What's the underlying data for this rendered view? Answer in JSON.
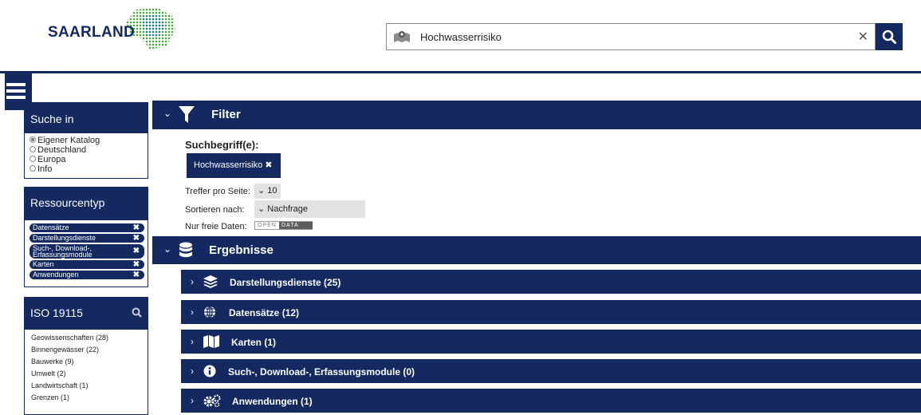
{
  "header": {
    "logo_text": "SAARLAND",
    "search": {
      "value": "Hochwasserrisiko",
      "clear_icon": "close-icon",
      "button_icon": "search-icon"
    }
  },
  "sidebar": {
    "suche_in": {
      "title": "Suche in",
      "options": [
        {
          "label": "Eigener Katalog",
          "selected": true
        },
        {
          "label": "Deutschland",
          "selected": false
        },
        {
          "label": "Europa",
          "selected": false
        },
        {
          "label": "Info",
          "selected": false
        }
      ]
    },
    "ressourcentyp": {
      "title": "Ressourcentyp",
      "items": [
        "Datensätze",
        "Darstellungsdienste",
        "Such-, Download-, Erfassungsmodule",
        "Karten",
        "Anwendungen"
      ],
      "remove_glyph": "✖"
    },
    "iso": {
      "title": "ISO 19115",
      "items": [
        "Geowissenschaften (28)",
        "Binnengewässer (22)",
        "Bauwerke (9)",
        "Umwelt (2)",
        "Landwirtschaft (1)",
        "Grenzen (1)"
      ]
    }
  },
  "filter": {
    "title": "Filter",
    "suchbegriff_label": "Suchbegriff(e):",
    "suchbegriff_chip": "Hochwasserrisiko ✖",
    "treffer_label": "Treffer pro Seite:",
    "treffer_value": "⌄ 10",
    "sort_label": "Sortieren nach:",
    "sort_value": "⌄ Nachfrage",
    "frei_label": "Nur freie Daten:",
    "open_text": "OPEN",
    "data_text": "DATA"
  },
  "results": {
    "title": "Ergebnisse",
    "groups": [
      {
        "label": "Darstellungsdienste (25)",
        "icon": "layers-icon"
      },
      {
        "label": "Datensätze (12)",
        "icon": "globe-icon"
      },
      {
        "label": "Karten (1)",
        "icon": "map-icon"
      },
      {
        "label": "Such-, Download-, Erfassungsmodule (0)",
        "icon": "info-icon"
      },
      {
        "label": "Anwendungen (1)",
        "icon": "gears-icon"
      }
    ]
  },
  "chevron_collapsed": "›",
  "chevron_expanded": "⌄",
  "colors": {
    "navy": "#13295f",
    "select_grey": "#e2e2e2"
  }
}
